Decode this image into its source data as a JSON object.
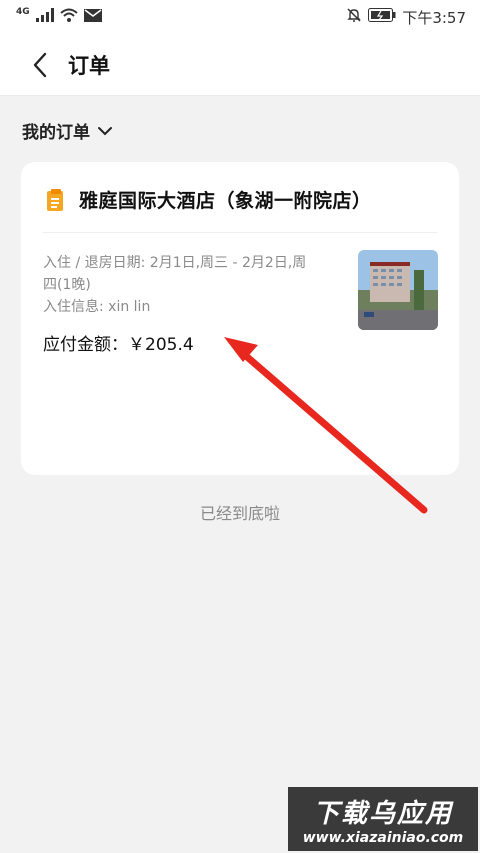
{
  "status_bar": {
    "network": "4G",
    "time": "下午3:57"
  },
  "header": {
    "title": "订单"
  },
  "filter": {
    "label": "我的订单"
  },
  "order": {
    "hotel_name": "雅庭国际大酒店（象湖一附院店）",
    "dates_line1": "入住 / 退房日期: 2月1日,周三 - 2月2日,周",
    "dates_line2": "四(1晚)",
    "guest_info": "入住信息: xin lin",
    "amount_label": "应付金额：",
    "amount_value": "￥205.4"
  },
  "footer": {
    "end_text": "已经到底啦"
  },
  "watermark": {
    "title": "下载乌应用",
    "url": "www.xiazainiao.com"
  },
  "colors": {
    "accent_orange": "#f5a623",
    "arrow_red": "#e8281e"
  }
}
